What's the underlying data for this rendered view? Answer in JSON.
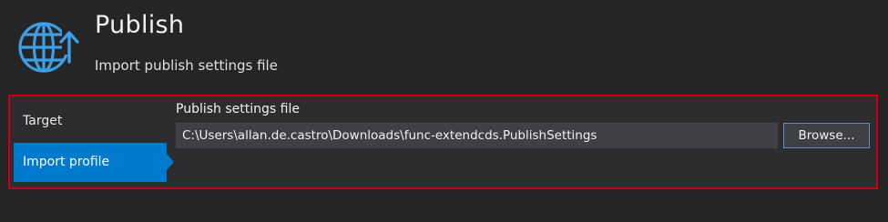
{
  "header": {
    "icon": "globe-publish-icon",
    "title": "Publish",
    "subtitle": "Import publish settings file"
  },
  "nav": {
    "items": [
      {
        "label": "Target",
        "selected": false
      },
      {
        "label": "Import profile",
        "selected": true
      }
    ]
  },
  "form": {
    "field_label": "Publish settings file",
    "file_path": "C:\\Users\\allan.de.castro\\Downloads\\func-extendcds.PublishSettings",
    "browse_label": "Browse..."
  },
  "colors": {
    "accent": "#007acc",
    "highlight_border": "#c5001f",
    "icon": "#3c9ee5",
    "background": "#252526"
  }
}
